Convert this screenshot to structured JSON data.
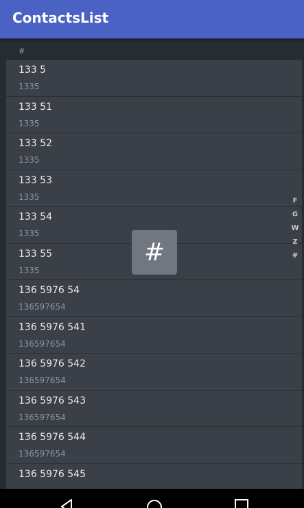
{
  "app": {
    "title": "ContactsList"
  },
  "list": {
    "section_header": "#",
    "items": [
      {
        "name": "133 5",
        "number": "1335"
      },
      {
        "name": "133 51",
        "number": "1335"
      },
      {
        "name": "133 52",
        "number": "1335"
      },
      {
        "name": "133 53",
        "number": "1335"
      },
      {
        "name": "133 54",
        "number": "1335"
      },
      {
        "name": "133 55",
        "number": "1335"
      },
      {
        "name": "136 5976 54",
        "number": "136597654"
      },
      {
        "name": "136 5976 541",
        "number": "136597654"
      },
      {
        "name": "136 5976 542",
        "number": "136597654"
      },
      {
        "name": "136 5976 543",
        "number": "136597654"
      },
      {
        "name": "136 5976 544",
        "number": "136597654"
      },
      {
        "name": "136 5976 545",
        "number": ""
      }
    ]
  },
  "index_bar": {
    "letters": [
      "F",
      "G",
      "W",
      "Z",
      "#"
    ]
  },
  "overlay": {
    "letter": "#"
  },
  "nav": {
    "icons": [
      "back-icon",
      "home-icon",
      "recents-icon"
    ]
  },
  "colors": {
    "appbar": "#4a62c4",
    "background": "#272c33",
    "row": "#3a3f48"
  }
}
